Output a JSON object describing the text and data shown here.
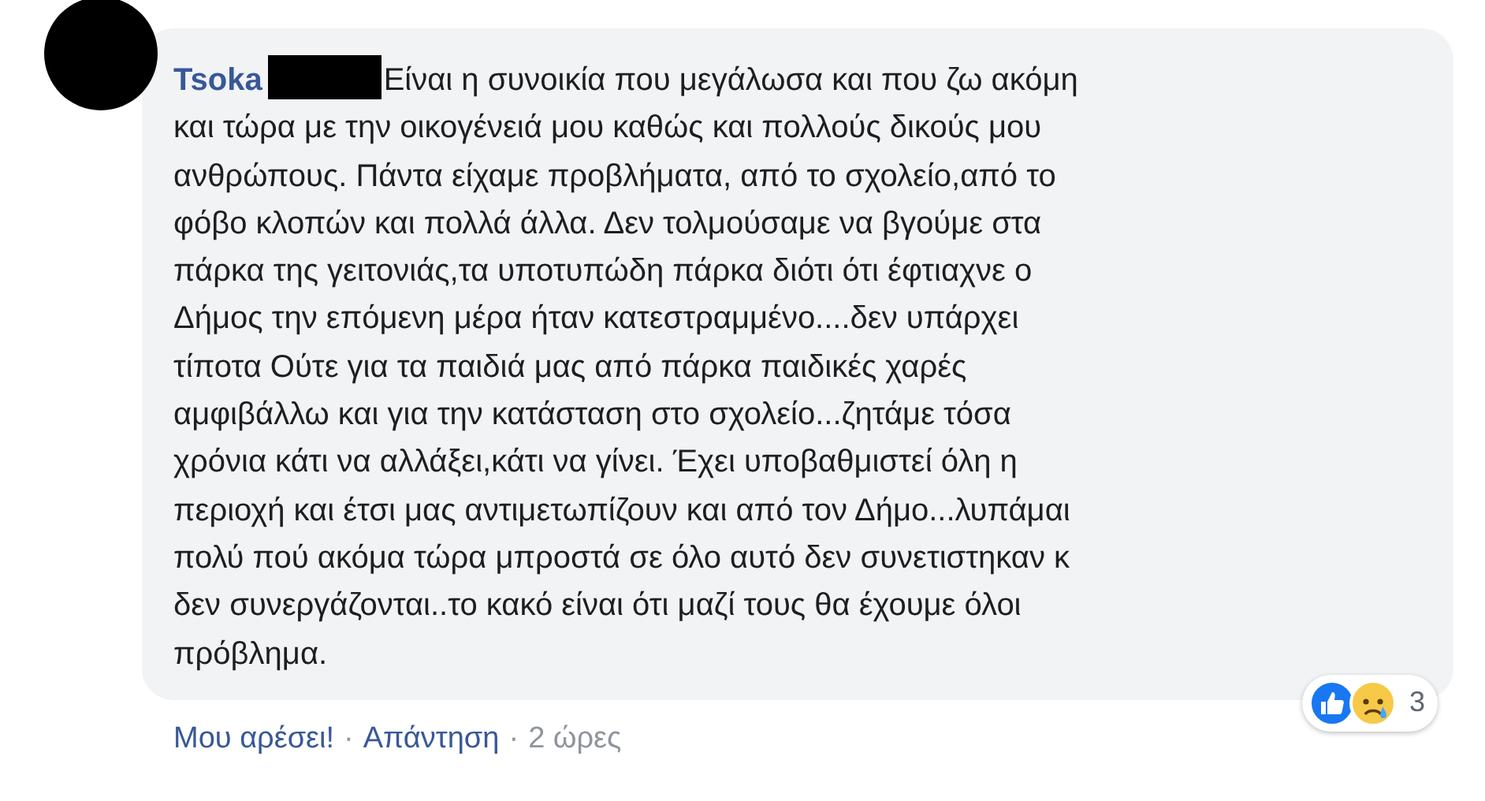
{
  "comment": {
    "author": "Tsoka",
    "author_redacted": true,
    "lines": [
      "Είναι η συνοικία που μεγάλωσα και που ζω ακόμη",
      "και τώρα με την οικογένειά μου καθώς και πολλούς δικούς μου",
      "ανθρώπους. Πάντα είχαμε προβλήματα, από το σχολείο,από το",
      "φόβο κλοπών και πολλά άλλα. Δεν τολμούσαμε να βγούμε στα",
      "πάρκα της γειτονιάς,τα υποτυπώδη πάρκα διότι ότι έφτιαχνε ο",
      "Δήμος την επόμενη μέρα ήταν κατεστραμμένο....δεν υπάρχει",
      "τίποτα Ούτε για τα παιδιά μας από πάρκα παιδικές χαρές",
      "αμφιβάλλω και για την κατάσταση στο σχολείο...ζητάμε τόσα",
      "χρόνια κάτι να αλλάξει,κάτι να γίνει. Έχει υποβαθμιστεί όλη η",
      "περιοχή και έτσι μας αντιμετωπίζουν και από τον Δήμο...λυπάμαι",
      "πολύ πού ακόμα τώρα μπροστά σε όλο αυτό δεν συνετιστηκαν κ",
      "δεν συνεργάζονται..το κακό είναι ότι μαζί τους θα έχουμε όλοι",
      "πρόβλημα."
    ],
    "reactions": {
      "count": "3"
    },
    "actions": [
      {
        "kind": "link",
        "label": "Μου αρέσει!"
      },
      {
        "kind": "sep",
        "label": "·"
      },
      {
        "kind": "link",
        "label": "Απάντηση"
      },
      {
        "kind": "sep",
        "label": "·"
      },
      {
        "kind": "time",
        "label": "2 ώρες"
      }
    ]
  }
}
